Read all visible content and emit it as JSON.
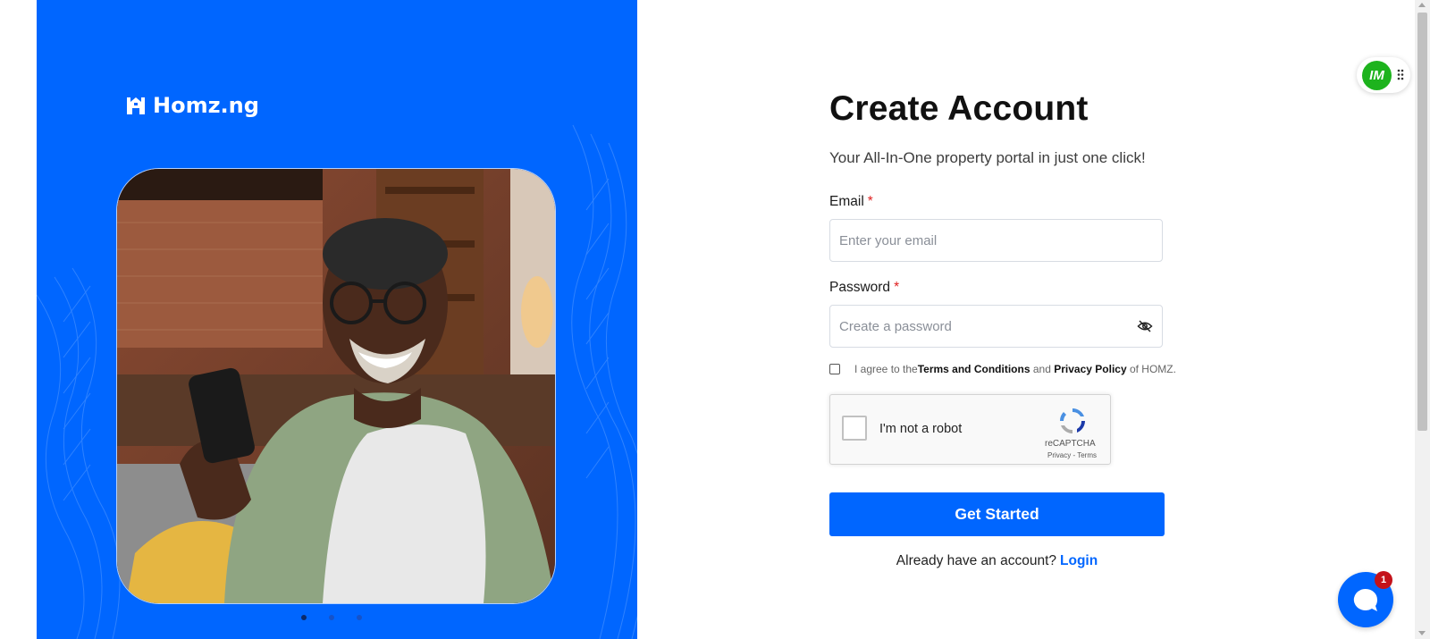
{
  "brand": {
    "name": "Homz.ng"
  },
  "hero": {
    "slides": 3,
    "active_slide": 1
  },
  "form": {
    "title": "Create Account",
    "subtitle": "Your All-In-One property portal in just one click!",
    "email": {
      "label": "Email",
      "required_mark": "*",
      "placeholder": "Enter your email"
    },
    "password": {
      "label": "Password",
      "required_mark": "*",
      "placeholder": "Create a password"
    },
    "agree": {
      "prefix": "I agree to the",
      "terms": "Terms and Conditions",
      "and": "and",
      "privacy": "Privacy Policy",
      "suffix": "of HOMZ."
    },
    "captcha": {
      "label": "I'm not a robot",
      "brand": "reCAPTCHA",
      "privacy": "Privacy",
      "separator": "-",
      "terms": "Terms"
    },
    "submit_label": "Get Started",
    "login_prompt": "Already have an account?",
    "login_link": "Login"
  },
  "widgets": {
    "im_avatar_text": "IM",
    "chat_badge_count": "1"
  },
  "colors": {
    "primary": "#0066ff",
    "required": "#e02020",
    "im_green": "#1db31d",
    "badge_red": "#c4121a"
  },
  "icons": [
    "homz-logo-icon",
    "eye-off-icon",
    "recaptcha-icon",
    "drag-grip-icon",
    "chat-icon"
  ]
}
